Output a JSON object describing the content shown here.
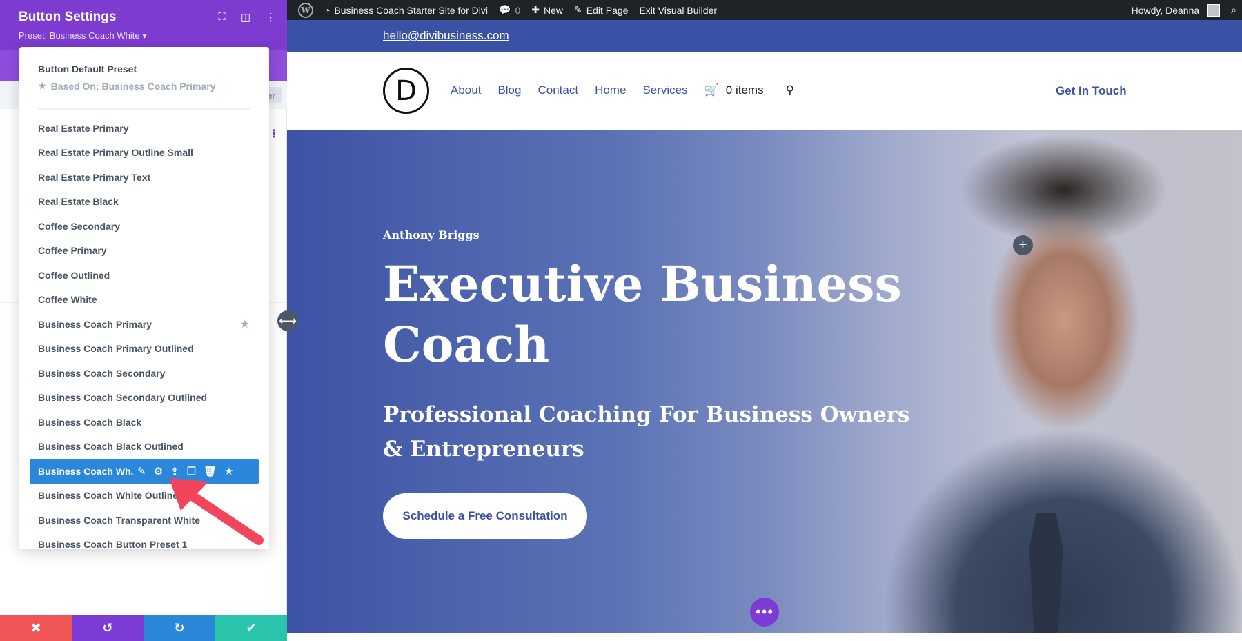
{
  "adminbar": {
    "site_name": "Business Coach Starter Site for Divi",
    "comments_count": "0",
    "new_label": "New",
    "edit_page": "Edit Page",
    "exit_builder": "Exit Visual Builder",
    "howdy": "Howdy, Deanna"
  },
  "site": {
    "email": "hello@divibusiness.com",
    "logo_letter": "D",
    "nav": [
      "About",
      "Blog",
      "Contact",
      "Home",
      "Services"
    ],
    "cart": "0 items",
    "cta_header": "Get In Touch"
  },
  "hero": {
    "name": "Anthony Briggs",
    "title": "Executive Business Coach",
    "subtitle": "Professional Coaching For Business Owners & Entrepreneurs",
    "button": "Schedule a Free Consultation"
  },
  "panel": {
    "title": "Button Settings",
    "preset": "Preset: Business Coach White ▾",
    "sub_fragment": "er",
    "default_preset": "Button Default Preset",
    "based_on": "Based On: Business Coach Primary",
    "presets": [
      "Real Estate Primary",
      "Real Estate Primary Outline Small",
      "Real Estate Primary Text",
      "Real Estate Black",
      "Coffee Secondary",
      "Coffee Primary",
      "Coffee Outlined",
      "Coffee White",
      "Business Coach Primary",
      "Business Coach Primary Outlined",
      "Business Coach Secondary",
      "Business Coach Secondary Outlined",
      "Business Coach Black",
      "Business Coach Black Outlined",
      "Business Coach Wh...",
      "Business Coach White Outlined",
      "Business Coach Transparent White",
      "Business Coach Button Preset 1"
    ]
  },
  "colors": {
    "brand_blue": "#3a52a6",
    "divi_purple": "#7e3bd0",
    "active_blue": "#2b87da",
    "arrow_red": "#f2445d"
  }
}
